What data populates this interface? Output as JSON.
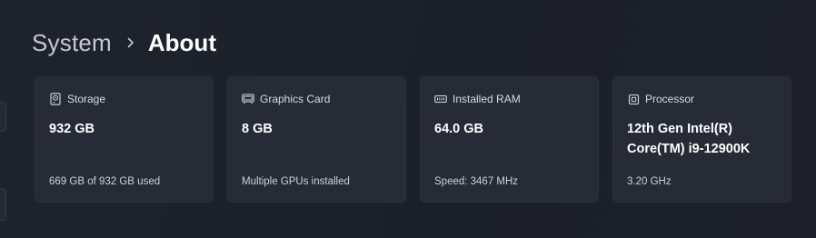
{
  "breadcrumb": {
    "parent": "System",
    "current": "About"
  },
  "cards": [
    {
      "icon": "storage-icon",
      "title": "Storage",
      "value": "932 GB",
      "detail": "669 GB of 932 GB used"
    },
    {
      "icon": "graphics-card-icon",
      "title": "Graphics Card",
      "value": "8 GB",
      "detail": "Multiple GPUs installed"
    },
    {
      "icon": "ram-icon",
      "title": "Installed RAM",
      "value": "64.0 GB",
      "detail": "Speed: 3467 MHz"
    },
    {
      "icon": "processor-icon",
      "title": "Processor",
      "value": "12th Gen Intel(R) Core(TM) i9-12900K",
      "detail": "3.20 GHz"
    }
  ],
  "colors": {
    "background": "#1c2029",
    "card": "#272b35",
    "text": "#ffffff",
    "muted": "#c7c9ce"
  }
}
